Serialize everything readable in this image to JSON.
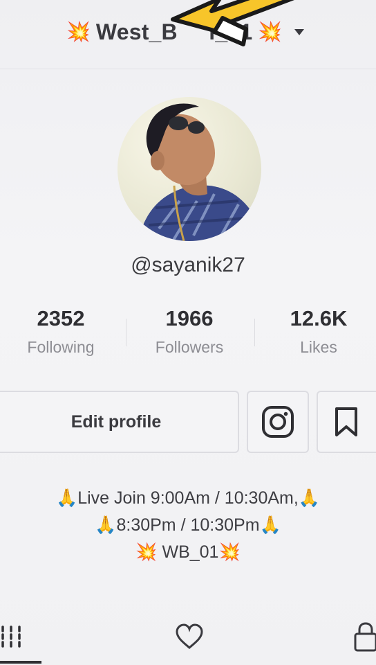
{
  "header": {
    "account_name": "West_B     l_01",
    "burst_emoji": "💥",
    "colors": {
      "arrow_fill": "#f7c52a",
      "arrow_stroke": "#1a1a1a"
    }
  },
  "profile": {
    "username": "@sayanik27",
    "avatar_icon": "profile-photo"
  },
  "stats": [
    {
      "value": "2352",
      "label": "Following"
    },
    {
      "value": "1966",
      "label": "Followers"
    },
    {
      "value": "12.6K",
      "label": "Likes"
    }
  ],
  "actions": {
    "edit_profile_label": "Edit profile",
    "instagram_icon": "instagram-icon",
    "bookmark_icon": "bookmark-icon"
  },
  "bio": {
    "lines": [
      "🙏Live Join 9:00Am / 10:30Am,🙏",
      "🙏8:30Pm / 10:30Pm🙏",
      "💥 WB_01💥"
    ]
  },
  "tabs": {
    "items": [
      "videos-grid-icon",
      "liked-heart-icon",
      "private-lock-icon"
    ],
    "active": "videos-grid-icon"
  }
}
